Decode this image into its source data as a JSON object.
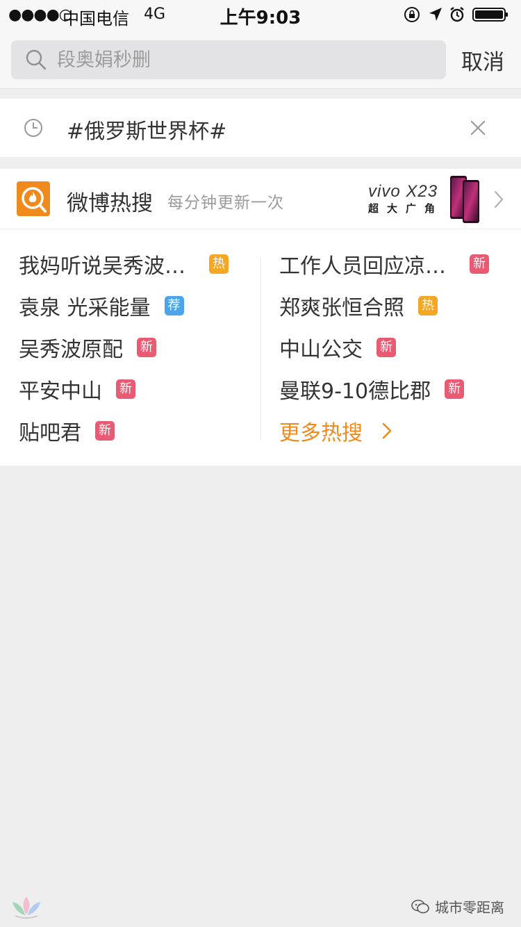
{
  "status_bar": {
    "signal": "●●●●○",
    "carrier": "中国电信",
    "network": "4G",
    "time": "上午9:03"
  },
  "search": {
    "placeholder": "段奥娟秒删",
    "cancel_label": "取消"
  },
  "history": {
    "items": [
      "#俄罗斯世界杯#"
    ]
  },
  "hot_search": {
    "title": "微博热搜",
    "subtitle": "每分钟更新一次",
    "ad": {
      "brand": "vivo X23",
      "slogan": "超大广角"
    },
    "left_items": [
      {
        "label": "我妈听说吴秀波…",
        "badge": "热",
        "badge_type": "hot"
      },
      {
        "label": "袁泉 光采能量",
        "badge": "荐",
        "badge_type": "rec"
      },
      {
        "label": "吴秀波原配",
        "badge": "新",
        "badge_type": "new"
      },
      {
        "label": "平安中山",
        "badge": "新",
        "badge_type": "new"
      },
      {
        "label": "贴吧君",
        "badge": "新",
        "badge_type": "new"
      }
    ],
    "right_items": [
      {
        "label": "工作人员回应凉…",
        "badge": "新",
        "badge_type": "new"
      },
      {
        "label": "郑爽张恒合照",
        "badge": "热",
        "badge_type": "hot"
      },
      {
        "label": "中山公交",
        "badge": "新",
        "badge_type": "new"
      },
      {
        "label": "曼联9-10德比郡",
        "badge": "新",
        "badge_type": "new"
      }
    ],
    "more_label": "更多热搜"
  },
  "footer": {
    "brand": "城市零距离"
  },
  "colors": {
    "accent_orange": "#f08a1c",
    "badge_hot": "#f5a623",
    "badge_new": "#e95a73",
    "badge_rec": "#4ca4eb",
    "background": "#eeeeee"
  }
}
